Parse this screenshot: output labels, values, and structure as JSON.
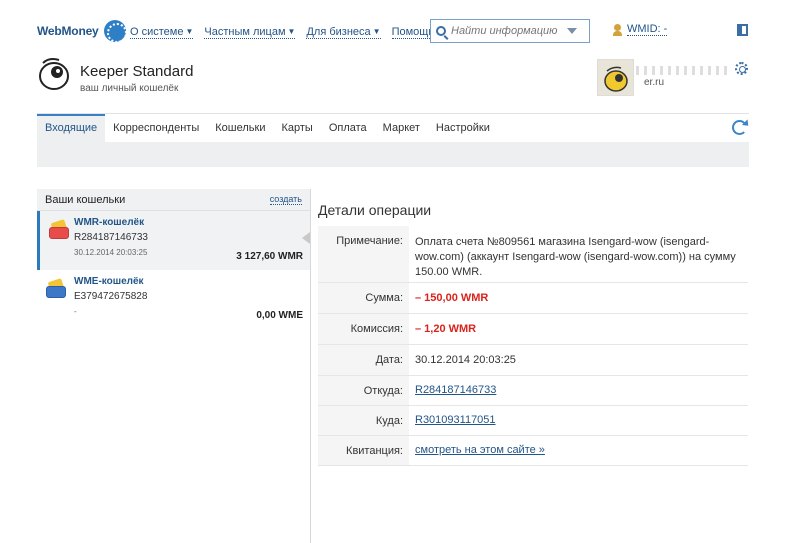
{
  "header": {
    "logo_text": "WebMoney",
    "nav": [
      {
        "label": "О системе"
      },
      {
        "label": "Частным лицам"
      },
      {
        "label": "Для бизнеса"
      },
      {
        "label": "Помощь"
      }
    ],
    "search_placeholder": "Найти информацию",
    "user_name": "WMID: -"
  },
  "keeper": {
    "title": "Keeper Standard",
    "subtitle": "ваш личный кошелёк",
    "account_caption": "er.ru"
  },
  "tabs": [
    {
      "label": "Входящие",
      "active": true
    },
    {
      "label": "Корреспонденты"
    },
    {
      "label": "Кошельки"
    },
    {
      "label": "Карты"
    },
    {
      "label": "Оплата"
    },
    {
      "label": "Маркет"
    },
    {
      "label": "Настройки"
    }
  ],
  "wallets": {
    "title": "Ваши кошельки",
    "create_label": "создать",
    "items": [
      {
        "name": "WMR-кошелёк",
        "number": "R284187146733",
        "date": "30.12.2014 20:03:25",
        "amount": "3 127,60 WMR",
        "colors": [
          "#e94b4b",
          "#f4c437"
        ]
      },
      {
        "name": "WME-кошелёк",
        "number": "E379472675828",
        "date": "-",
        "amount": "0,00 WME",
        "colors": [
          "#3d77c7",
          "#f4c437"
        ]
      }
    ]
  },
  "details": {
    "title": "Детали операции",
    "rows": [
      {
        "label": "Примечание:",
        "value": "Оплата счета №809561 магазина Isengard-wow (isengard-wow.com) (аккаунт Isengard-wow (isengard-wow.com)) на сумму 150.00 WMR."
      },
      {
        "label": "Сумма:",
        "value": "– 150,00 WMR"
      },
      {
        "label": "Комиссия:",
        "value": "– 1,20 WMR"
      },
      {
        "label": "Дата:",
        "value": "30.12.2014 20:03:25"
      },
      {
        "label": "Откуда:",
        "value": "R284187146733"
      },
      {
        "label": "Куда:",
        "value": "R301093117051"
      },
      {
        "label": "Квитанция:",
        "value": "смотреть на этом сайте »"
      }
    ]
  }
}
